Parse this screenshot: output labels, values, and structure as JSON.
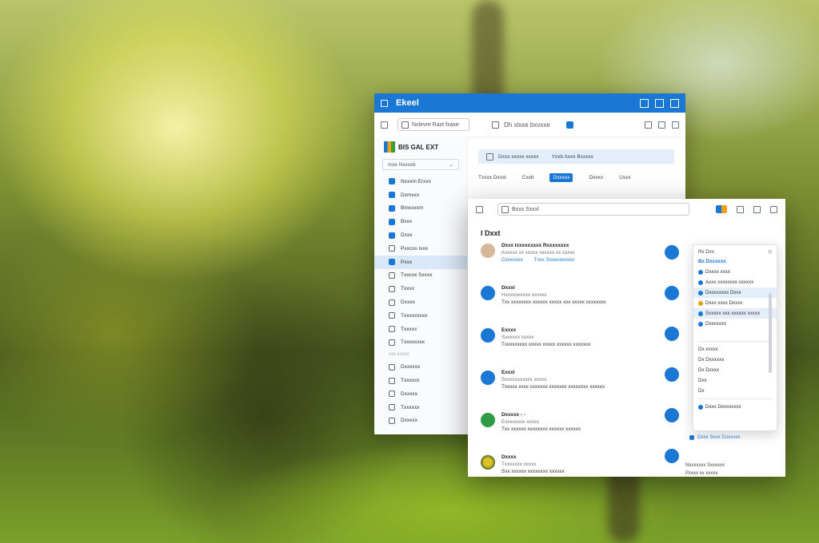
{
  "colors": {
    "accent": "#1a78d4",
    "selected": "#d9e8f8",
    "info_bar": "#e3eef9"
  },
  "back_window": {
    "title": "Ekeel",
    "search_placeholder": "Nxlevre Raxt fxaxe",
    "toolbar_label": "Dh xlxxe bxvxxe",
    "brand": "BIS GAL EXT",
    "filter_label": "Ixxe  Nxxxxk",
    "nav_items": [
      {
        "label": "Nxxxm Erxxx",
        "icon": "blue-square-icon"
      },
      {
        "label": "Dxmxxx",
        "icon": "blue-square-icon"
      },
      {
        "label": "Bmxxxxm",
        "icon": "blue-square-icon"
      },
      {
        "label": "Bxxx",
        "icon": "blue-square-icon"
      },
      {
        "label": "Dxxx",
        "icon": "blue-square-icon"
      },
      {
        "label": "Pxxcxx Ixxx",
        "icon": "outline-icon"
      },
      {
        "label": "Pxxx",
        "icon": "image-icon"
      },
      {
        "label": "Txxcxx Sxxxx",
        "icon": "outline-icon"
      },
      {
        "label": "Txxxx",
        "icon": "outline-icon"
      },
      {
        "label": "Dxxxx",
        "icon": "outline-icon"
      },
      {
        "label": "Txxxxxxxxx",
        "icon": "outline-icon"
      },
      {
        "label": "Txxxxx",
        "icon": "outline-icon"
      },
      {
        "label": "Txxxxxxxx",
        "icon": "outline-icon"
      }
    ],
    "nav_divider_label": "xxx xxxxx",
    "nav_items_2": [
      {
        "label": "Dxxxxxx",
        "icon": "outline-icon"
      },
      {
        "label": "Txxxxxx",
        "icon": "outline-icon"
      },
      {
        "label": "Dxxxxx",
        "icon": "outline-icon"
      },
      {
        "label": "Txxxxxx",
        "icon": "outline-icon"
      },
      {
        "label": "Dxxxxx",
        "icon": "outline-icon"
      }
    ],
    "info_bar": {
      "text_a": "Dxxx xxxxx xxxxx",
      "text_b": "Yxxb Axxx Bxxxxx"
    },
    "tabs": [
      "Txxxx Dxxxl",
      "Cxxb",
      "Dxxxxx",
      "Dxxxx",
      "Uxxx"
    ]
  },
  "front_window": {
    "search_text": "Bxxx Sxxxl",
    "heading": "I Dxxt",
    "feed": [
      {
        "name": "Dxxx Ixxxxxxxxx Rxxxxxxxx",
        "meta": "Axxxxx xx xxxxx xxxxxx xx xxxxx",
        "links": [
          "Cxxxxxxx",
          "Txxx Sxxxxxxxxxx"
        ],
        "avatar": "tan"
      },
      {
        "name": "Dxxxl",
        "meta": "Hxxxxxxxxxx xxxxxx",
        "body": "Txx xxxxxxxx xxxxxx xxxxx xxx xxxxx xxxxxxxx",
        "avatar": "blue"
      },
      {
        "name": "Exxxx",
        "meta": "Sxxxxxx xxxxx",
        "body": "Txxxxxxxxx xxxxx xxxxx xxxxxx xxxxxxx",
        "avatar": "blue"
      },
      {
        "name": "Exxxl",
        "meta": "Sxxxxxxxxxxx xxxxx",
        "body": "Txxxxx xxxx xxxxxxx xxxxxxx xxxxxxxx xxxxxx",
        "avatar": "blue"
      },
      {
        "name": "Dxxxxx - -",
        "meta": "Exxxxxxxx xxxxx",
        "body": "Txx xxxxxx xxxxxxxx xxxxxx xxxxxx",
        "avatar": "green"
      },
      {
        "name": "Dxxxx",
        "meta": "Txxxxxxx xxxxx",
        "body": "Sxx xxxxxx xxxxxxxx xxxxxx",
        "avatar": "yellow"
      }
    ],
    "right_last_text": [
      "Nxxxxxxx Sxxxxxx",
      "Pxxxx xx xxxxx"
    ],
    "dropdown": {
      "header": "Rx Dxx",
      "sub": "Bx Dxxxxxx",
      "rows": [
        "Dxxxx xxxx",
        "Axxx xxxxxxxx xxxxxx",
        "Dxxxxxxxx Dxxx",
        "Dxxx xxxx Dxxxx",
        "Sxxxxx xxx xxxxxx xxxxx",
        "Dxxxxxxx"
      ],
      "lower": [
        "Dx xxxxx",
        "Dx Dxxxxxx",
        "Dx Dxxxx",
        "Dxx",
        "Dx"
      ],
      "footer": "Dxxx Dxxxxxxxx"
    },
    "bottom_link": "Dxxx Sxxx Dxxxxxx"
  }
}
